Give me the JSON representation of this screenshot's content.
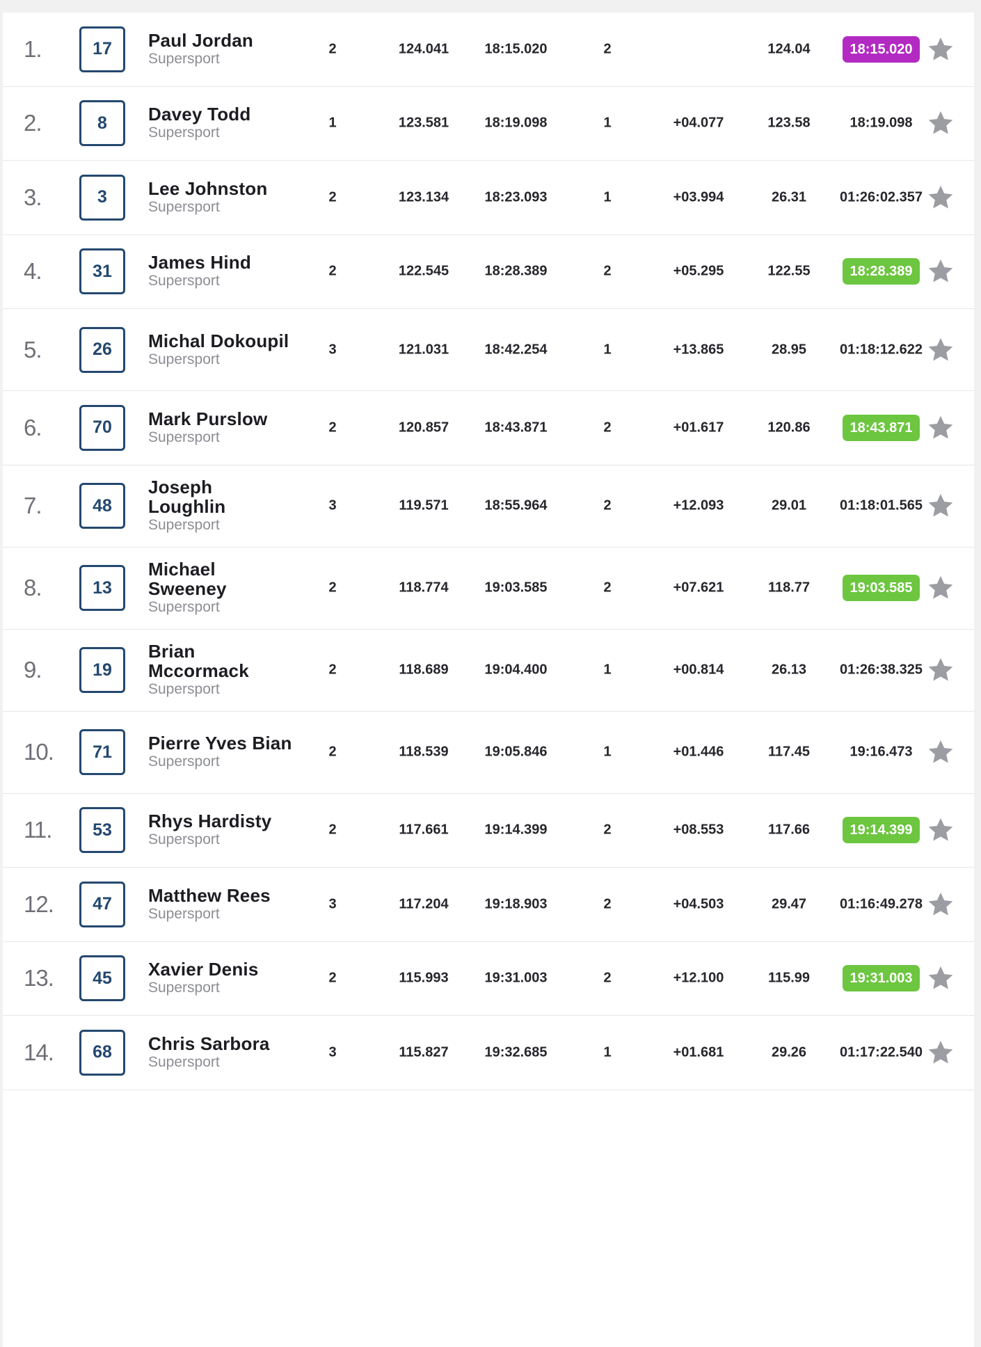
{
  "class_label": "Supersport",
  "colors": {
    "bib_border": "#24486f",
    "purple_best": "#b22ac2",
    "green_best": "#6cc63f",
    "star": "#9c9da3"
  },
  "rows": [
    {
      "pos": "1.",
      "bib": "17",
      "name": "Paul Jordan",
      "class": "Supersport",
      "laps": "2",
      "speed": "124.041",
      "time": "18:15.020",
      "lap": "2",
      "gap": "",
      "speed2": "124.04",
      "best": "18:15.020",
      "highlight": "purple",
      "star_icon": "star-icon"
    },
    {
      "pos": "2.",
      "bib": "8",
      "name": "Davey Todd",
      "class": "Supersport",
      "laps": "1",
      "speed": "123.581",
      "time": "18:19.098",
      "lap": "1",
      "gap": "+04.077",
      "speed2": "123.58",
      "best": "18:19.098",
      "highlight": "none",
      "star_icon": "star-icon"
    },
    {
      "pos": "3.",
      "bib": "3",
      "name": "Lee Johnston",
      "class": "Supersport",
      "laps": "2",
      "speed": "123.134",
      "time": "18:23.093",
      "lap": "1",
      "gap": "+03.994",
      "speed2": "26.31",
      "best": "01:26:02.357",
      "highlight": "none",
      "star_icon": "star-icon"
    },
    {
      "pos": "4.",
      "bib": "31",
      "name": "James Hind",
      "class": "Supersport",
      "laps": "2",
      "speed": "122.545",
      "time": "18:28.389",
      "lap": "2",
      "gap": "+05.295",
      "speed2": "122.55",
      "best": "18:28.389",
      "highlight": "green",
      "star_icon": "star-icon"
    },
    {
      "pos": "5.",
      "bib": "26",
      "name": "Michal Dokoupil",
      "class": "Supersport",
      "laps": "3",
      "speed": "121.031",
      "time": "18:42.254",
      "lap": "1",
      "gap": "+13.865",
      "speed2": "28.95",
      "best": "01:18:12.622",
      "highlight": "none",
      "star_icon": "star-icon"
    },
    {
      "pos": "6.",
      "bib": "70",
      "name": "Mark Purslow",
      "class": "Supersport",
      "laps": "2",
      "speed": "120.857",
      "time": "18:43.871",
      "lap": "2",
      "gap": "+01.617",
      "speed2": "120.86",
      "best": "18:43.871",
      "highlight": "green",
      "star_icon": "star-icon"
    },
    {
      "pos": "7.",
      "bib": "48",
      "name": "Joseph Loughlin",
      "class": "Supersport",
      "laps": "3",
      "speed": "119.571",
      "time": "18:55.964",
      "lap": "2",
      "gap": "+12.093",
      "speed2": "29.01",
      "best": "01:18:01.565",
      "highlight": "none",
      "star_icon": "star-icon"
    },
    {
      "pos": "8.",
      "bib": "13",
      "name": "Michael Sweeney",
      "class": "Supersport",
      "laps": "2",
      "speed": "118.774",
      "time": "19:03.585",
      "lap": "2",
      "gap": "+07.621",
      "speed2": "118.77",
      "best": "19:03.585",
      "highlight": "green",
      "star_icon": "star-icon"
    },
    {
      "pos": "9.",
      "bib": "19",
      "name": "Brian Mccormack",
      "class": "Supersport",
      "laps": "2",
      "speed": "118.689",
      "time": "19:04.400",
      "lap": "1",
      "gap": "+00.814",
      "speed2": "26.13",
      "best": "01:26:38.325",
      "highlight": "none",
      "star_icon": "star-icon"
    },
    {
      "pos": "10.",
      "bib": "71",
      "name": "Pierre Yves Bian",
      "class": "Supersport",
      "laps": "2",
      "speed": "118.539",
      "time": "19:05.846",
      "lap": "1",
      "gap": "+01.446",
      "speed2": "117.45",
      "best": "19:16.473",
      "highlight": "none",
      "star_icon": "star-icon"
    },
    {
      "pos": "11.",
      "bib": "53",
      "name": "Rhys Hardisty",
      "class": "Supersport",
      "laps": "2",
      "speed": "117.661",
      "time": "19:14.399",
      "lap": "2",
      "gap": "+08.553",
      "speed2": "117.66",
      "best": "19:14.399",
      "highlight": "green",
      "star_icon": "star-icon"
    },
    {
      "pos": "12.",
      "bib": "47",
      "name": "Matthew Rees",
      "class": "Supersport",
      "laps": "3",
      "speed": "117.204",
      "time": "19:18.903",
      "lap": "2",
      "gap": "+04.503",
      "speed2": "29.47",
      "best": "01:16:49.278",
      "highlight": "none",
      "star_icon": "star-icon"
    },
    {
      "pos": "13.",
      "bib": "45",
      "name": "Xavier Denis",
      "class": "Supersport",
      "laps": "2",
      "speed": "115.993",
      "time": "19:31.003",
      "lap": "2",
      "gap": "+12.100",
      "speed2": "115.99",
      "best": "19:31.003",
      "highlight": "green",
      "star_icon": "star-icon"
    },
    {
      "pos": "14.",
      "bib": "68",
      "name": "Chris Sarbora",
      "class": "Supersport",
      "laps": "3",
      "speed": "115.827",
      "time": "19:32.685",
      "lap": "1",
      "gap": "+01.681",
      "speed2": "29.26",
      "best": "01:17:22.540",
      "highlight": "none",
      "star_icon": "star-icon"
    }
  ]
}
